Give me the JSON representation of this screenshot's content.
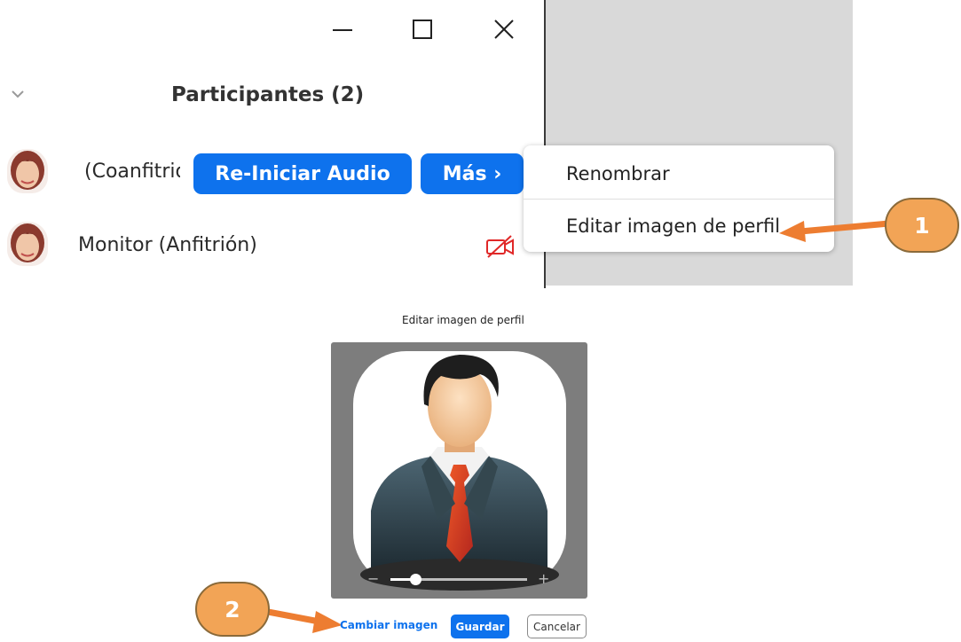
{
  "window": {
    "controls": {
      "minimize_icon": "minimize-icon",
      "maximize_icon": "maximize-icon",
      "close_icon": "close-icon"
    }
  },
  "participants_panel": {
    "title": "Participantes (2)",
    "collapse_icon": "chevron-down-icon",
    "participants": [
      {
        "name": "(Coanfitrión)",
        "avatar_icon": "user-avatar"
      },
      {
        "name": "Monitor (Anfitrión)",
        "avatar_icon": "user-avatar",
        "status_icon": "video-off-icon"
      }
    ],
    "buttons": {
      "restart_audio": "Re-Iniciar Audio",
      "more": "Más ›"
    }
  },
  "context_menu": {
    "items": [
      "Renombrar",
      "Editar imagen de perfil"
    ]
  },
  "callouts": {
    "step1": "1",
    "step2": "2"
  },
  "edit_profile_dialog": {
    "title": "Editar imagen de perfil",
    "zoom_level": 0.18,
    "buttons": {
      "change_image": "Cambiar imagen",
      "save": "Guardar",
      "cancel": "Cancelar"
    }
  },
  "colors": {
    "accent": "#0e72ed",
    "callout": "#f2a456",
    "callout_arrow": "#ed7d31",
    "video_off": "#e02828"
  }
}
